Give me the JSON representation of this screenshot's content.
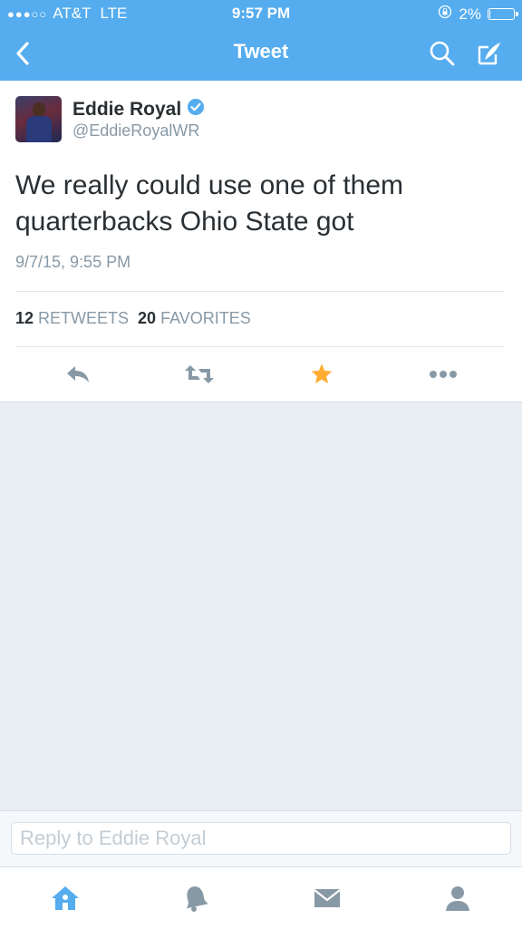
{
  "status_bar": {
    "signal": "●●●○○",
    "carrier": "AT&T",
    "network": "LTE",
    "time": "9:57 PM",
    "battery": "2%",
    "battery_level": 0.02
  },
  "nav": {
    "title": "Tweet",
    "icons": [
      "back-chevron-icon",
      "search-icon",
      "compose-icon"
    ]
  },
  "tweet": {
    "author_name": "Eddie Royal",
    "handle": "@EddieRoyalWR",
    "verified": true,
    "text": "We really could use one of them quarterbacks Ohio State got",
    "timestamp": "9/7/15, 9:55 PM",
    "retweets_count": "12",
    "retweets_label": "RETWEETS",
    "favorites_count": "20",
    "favorites_label": "FAVORITES",
    "favorited": true
  },
  "actions": [
    "reply-icon",
    "retweet-icon",
    "favorite-icon",
    "more-icon"
  ],
  "reply": {
    "placeholder": "Reply to Eddie Royal"
  },
  "tabbar": {
    "items": [
      {
        "icon": "home-icon",
        "active": true
      },
      {
        "icon": "notifications-icon",
        "active": false
      },
      {
        "icon": "messages-icon",
        "active": false
      },
      {
        "icon": "me-icon",
        "active": false
      }
    ]
  },
  "colors": {
    "brand_blue": "#55acee",
    "gray_icon": "#8899a6",
    "favorite_star": "#ffac33"
  }
}
